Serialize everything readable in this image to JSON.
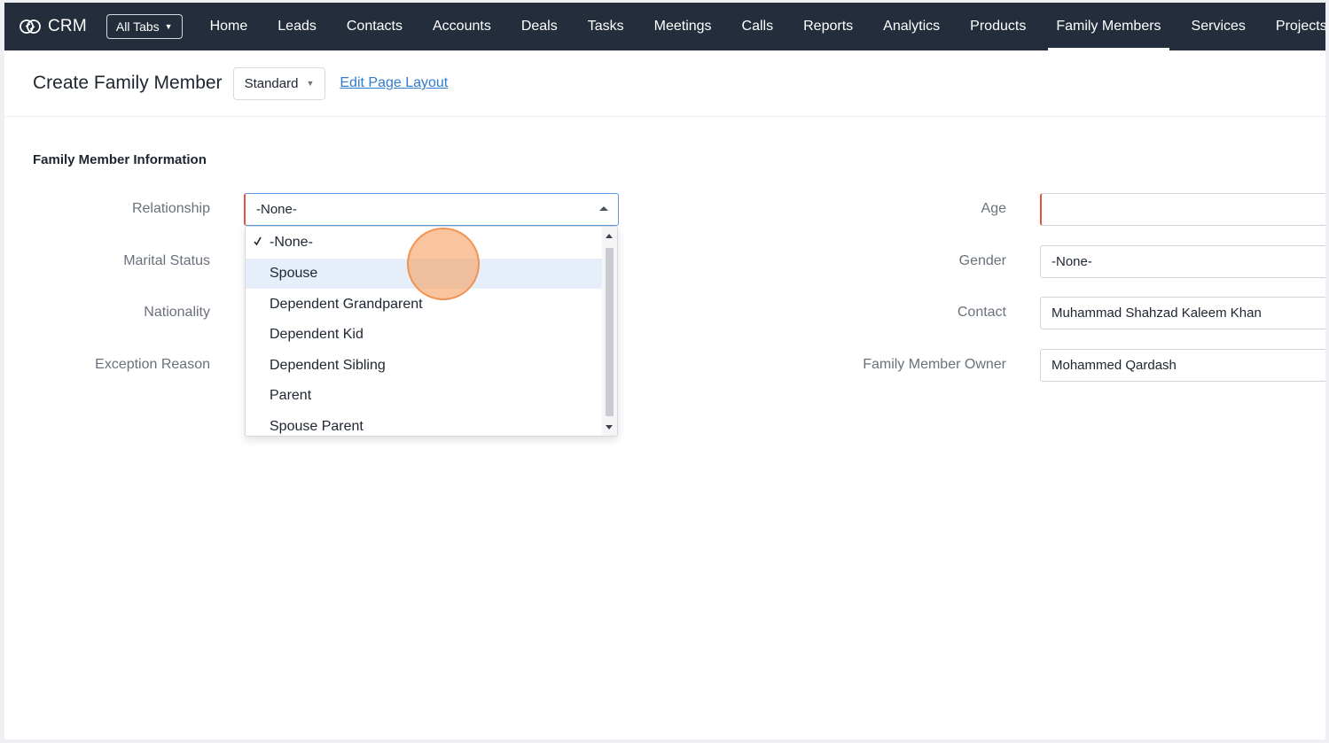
{
  "nav": {
    "brand": "CRM",
    "all_tabs": "All Tabs",
    "tabs": [
      {
        "label": "Home"
      },
      {
        "label": "Leads"
      },
      {
        "label": "Contacts"
      },
      {
        "label": "Accounts"
      },
      {
        "label": "Deals"
      },
      {
        "label": "Tasks"
      },
      {
        "label": "Meetings"
      },
      {
        "label": "Calls"
      },
      {
        "label": "Reports"
      },
      {
        "label": "Analytics"
      },
      {
        "label": "Products"
      },
      {
        "label": "Family Members",
        "active": true
      },
      {
        "label": "Services"
      },
      {
        "label": "Projects"
      }
    ]
  },
  "header": {
    "title": "Create Family Member",
    "layout_value": "Standard",
    "edit_layout_link": "Edit Page Layout"
  },
  "section": {
    "title": "Family Member Information"
  },
  "fields": {
    "relationship": {
      "label": "Relationship",
      "value": "-None-"
    },
    "marital_status": {
      "label": "Marital Status"
    },
    "nationality": {
      "label": "Nationality"
    },
    "exception_reason": {
      "label": "Exception Reason"
    },
    "age": {
      "label": "Age",
      "value": ""
    },
    "gender": {
      "label": "Gender",
      "value": "-None-"
    },
    "contact": {
      "label": "Contact",
      "value": "Muhammad Shahzad Kaleem Khan"
    },
    "owner": {
      "label": "Family Member Owner",
      "value": "Mohammed Qardash"
    }
  },
  "relationship_dropdown": {
    "options": [
      "-None-",
      "Spouse",
      "Dependent Grandparent",
      "Dependent Kid",
      "Dependent Sibling",
      "Parent",
      "Spouse Parent"
    ],
    "selected": "-None-",
    "hovered": "Spouse"
  },
  "colors": {
    "nav_bg": "#232d3b",
    "link": "#2f7bcc",
    "required_marker": "#e2533f",
    "hover_bg": "#e5eef9",
    "click_indicator": "#f6a062"
  }
}
